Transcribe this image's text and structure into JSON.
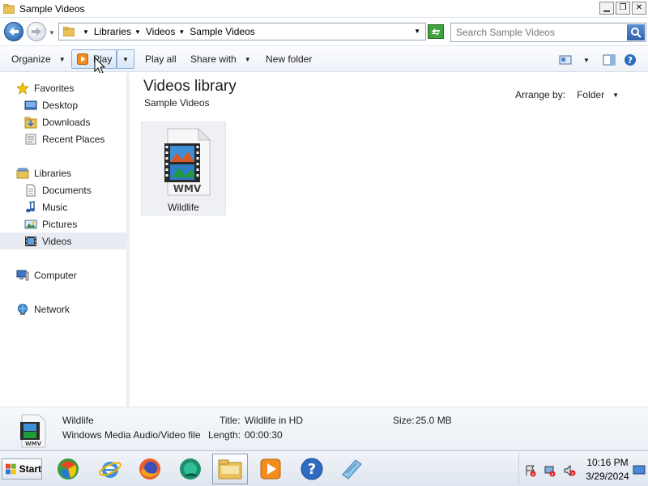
{
  "window": {
    "title": "Sample Videos",
    "minimize_glyph": "▁",
    "restore_glyph": "❐",
    "close_glyph": "✕"
  },
  "address": {
    "crumbs": [
      "Libraries",
      "Videos",
      "Sample Videos"
    ],
    "search_placeholder": "Search Sample Videos"
  },
  "toolbar": {
    "organize": "Organize",
    "play": "Play",
    "play_all": "Play all",
    "share_with": "Share with",
    "new_folder": "New folder"
  },
  "nav": {
    "favorites": {
      "label": "Favorites",
      "items": [
        {
          "label": "Desktop",
          "icon": "desktop-icon"
        },
        {
          "label": "Downloads",
          "icon": "downloads-icon"
        },
        {
          "label": "Recent Places",
          "icon": "recent-places-icon"
        }
      ]
    },
    "libraries": {
      "label": "Libraries",
      "items": [
        {
          "label": "Documents",
          "icon": "documents-icon"
        },
        {
          "label": "Music",
          "icon": "music-icon"
        },
        {
          "label": "Pictures",
          "icon": "pictures-icon"
        },
        {
          "label": "Videos",
          "icon": "videos-icon",
          "selected": true
        }
      ]
    },
    "computer": "Computer",
    "network": "Network"
  },
  "content": {
    "library_title": "Videos library",
    "library_subtitle": "Sample Videos",
    "arrange_label": "Arrange by:",
    "arrange_value": "Folder",
    "files": [
      {
        "name": "Wildlife",
        "badge": "WMV",
        "icon": "wmv-video-file-icon"
      }
    ]
  },
  "details": {
    "name": "Wildlife",
    "type": "Windows Media Audio/Video file",
    "title_label": "Title:",
    "title_value": "Wildlife in HD",
    "length_label": "Length:",
    "length_value": "00:00:30",
    "size_label": "Size:",
    "size_value": "25.0 MB",
    "thumb_badge": "WMV"
  },
  "taskbar": {
    "start_label": "Start",
    "apps": [
      "windows-media-player-icon",
      "internet-explorer-icon",
      "firefox-icon",
      "chrome-like-icon",
      "explorer-icon",
      "media-center-icon",
      "help-icon",
      "notepad-icon"
    ],
    "time": "10:16 PM",
    "date": "3/29/2024"
  },
  "colors": {
    "accent": "#1c5aa6",
    "selection": "#e8ecf2",
    "refresh_green": "#3ea33e"
  }
}
